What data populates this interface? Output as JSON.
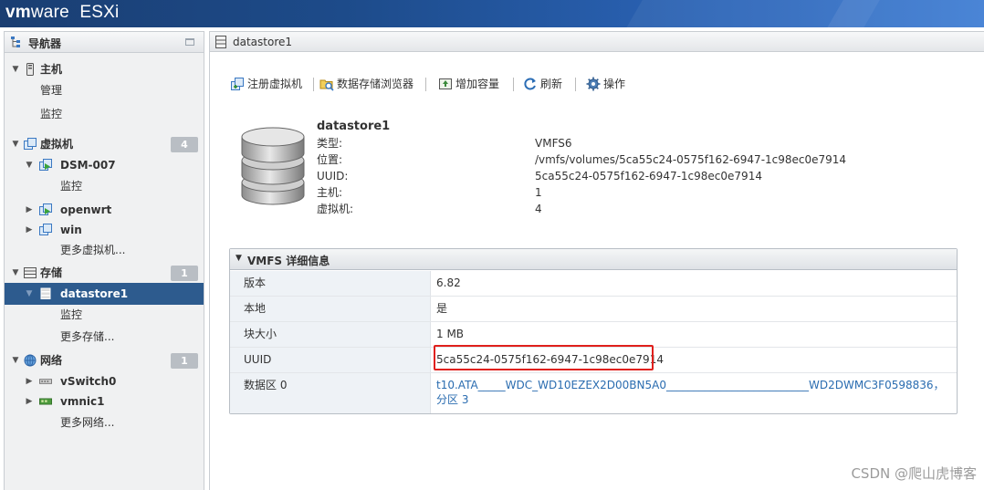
{
  "header": {
    "brand_bold": "vm",
    "brand_rest": "ware",
    "product": "ESXi"
  },
  "navigator": {
    "title": "导航器",
    "items": [
      {
        "label": "主机",
        "icon": "host-icon"
      },
      {
        "label": "管理"
      },
      {
        "label": "监控"
      },
      {
        "label": "虚拟机",
        "badge": "4",
        "icon": "vm-icon"
      },
      {
        "label": "DSM-007",
        "icon": "vm-running-icon"
      },
      {
        "label": "监控"
      },
      {
        "label": "openwrt",
        "icon": "vm-running-icon"
      },
      {
        "label": "win",
        "icon": "vm-icon"
      },
      {
        "label": "更多虚拟机..."
      },
      {
        "label": "存储",
        "badge": "1",
        "icon": "storage-icon"
      },
      {
        "label": "datastore1",
        "icon": "datastore-icon"
      },
      {
        "label": "监控"
      },
      {
        "label": "更多存储..."
      },
      {
        "label": "网络",
        "badge": "1",
        "icon": "network-icon"
      },
      {
        "label": "vSwitch0",
        "icon": "vswitch-icon"
      },
      {
        "label": "vmnic1",
        "icon": "nic-icon"
      },
      {
        "label": "更多网络..."
      }
    ]
  },
  "main": {
    "title": "datastore1",
    "toolbar": {
      "register_vm": "注册虚拟机",
      "browser": "数据存储浏览器",
      "increase": "增加容量",
      "refresh": "刷新",
      "actions": "操作"
    },
    "summary": {
      "name": "datastore1",
      "rows": [
        {
          "k": "类型:",
          "v": "VMFS6"
        },
        {
          "k": "位置:",
          "v": "/vmfs/volumes/5ca55c24-0575f162-6947-1c98ec0e7914"
        },
        {
          "k": "UUID:",
          "v": "5ca55c24-0575f162-6947-1c98ec0e7914"
        },
        {
          "k": "主机:",
          "v": "1"
        },
        {
          "k": "虚拟机:",
          "v": "4"
        }
      ]
    },
    "vmfs": {
      "title": "VMFS 详细信息",
      "rows": [
        {
          "k": "版本",
          "v": "6.82"
        },
        {
          "k": "本地",
          "v": "是"
        },
        {
          "k": "块大小",
          "v": "1 MB"
        },
        {
          "k": "UUID",
          "v": "5ca55c24-0575f162-6947-1c98ec0e7914"
        },
        {
          "k": "数据区 0",
          "v": "t10.ATA_____WDC_WD10EZEX2D00BN5A0__________________________WD2DWMC3F0598836，分区 3"
        }
      ]
    }
  },
  "watermark": "CSDN @爬山虎博客",
  "colors": {
    "selected": "#2d5b8e",
    "highlight": "#e0201c",
    "link": "#2a6cb0"
  }
}
